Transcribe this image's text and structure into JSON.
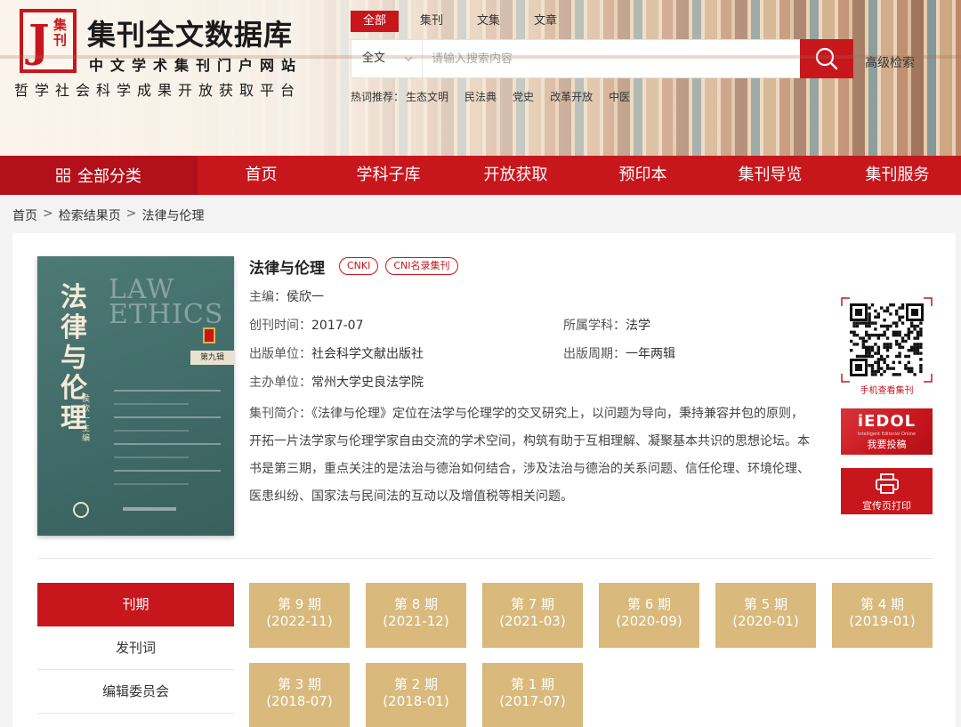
{
  "logo": {
    "mark_letter": "J",
    "mark_chars": "集刊",
    "title": "集刊全文数据库",
    "subtitle": "中文学术集刊门户网站",
    "slogan": "哲学社会科学成果开放获取平台"
  },
  "search": {
    "tabs": [
      {
        "label": "全部",
        "active": true
      },
      {
        "label": "集刊",
        "active": false
      },
      {
        "label": "文集",
        "active": false
      },
      {
        "label": "文章",
        "active": false
      }
    ],
    "scope": "全文",
    "placeholder": "请输入搜索内容",
    "advanced": "高级检索",
    "hot_label": "热词推荐：",
    "hot_words": [
      "生态文明",
      "民法典",
      "党史",
      "改革开放",
      "中医"
    ]
  },
  "nav": {
    "all_categories": "全部分类",
    "items": [
      "首页",
      "学科子库",
      "开放获取",
      "预印本",
      "集刊导览",
      "集刊服务"
    ]
  },
  "breadcrumb": [
    "首页",
    "检索结果页",
    "法律与伦理"
  ],
  "journal": {
    "title": "法律与伦理",
    "tags": [
      "CNKI",
      "CNI名录集刊"
    ],
    "editor_label": "主编：",
    "editor": "侯欣一",
    "founded_label": "创刊时间：",
    "founded": "2017-07",
    "subject_label": "所属学科：",
    "subject": "法学",
    "publisher_label": "出版单位：",
    "publisher": "社会科学文献出版社",
    "cycle_label": "出版周期：",
    "cycle": "一年两辑",
    "host_label": "主办单位：",
    "host": "常州大学史良法学院",
    "intro_label": "集刊简介：",
    "intro": "《法律与伦理》定位在法学与伦理学的交叉研究上，以问题为导向，秉持兼容并包的原则，开拓一片法学家与伦理学家自由交流的学术空间，构筑有助于互相理解、凝聚基本共识的思想论坛。本书是第三期，重点关注的是法治与德治如何结合，涉及法治与德治的关系问题、信任伦理、环境伦理、医患纠纷、国家法与民间法的互动以及增值税等相关问题。"
  },
  "cover": {
    "title_chars": "法律与伦理",
    "latin_top": "LAW",
    "latin_bottom": "ETHICS",
    "issue": "第九辑",
    "editors": "侯欣一 主编"
  },
  "sidebar_right": {
    "qr_caption": "手机查看集刊",
    "edol_logo": "iEDOL",
    "edol_small": "Intelligent Editorial Online",
    "submit": "我要投稿",
    "print": "宣传页打印"
  },
  "side_menu": [
    {
      "label": "刊期",
      "active": true
    },
    {
      "label": "发刊词",
      "active": false
    },
    {
      "label": "编辑委员会",
      "active": false
    }
  ],
  "issues": [
    {
      "no": "第 9 期",
      "date": "(2022-11)"
    },
    {
      "no": "第 8 期",
      "date": "(2021-12)"
    },
    {
      "no": "第 7 期",
      "date": "(2021-03)"
    },
    {
      "no": "第 6 期",
      "date": "(2020-09)"
    },
    {
      "no": "第 5 期",
      "date": "(2020-01)"
    },
    {
      "no": "第 4 期",
      "date": "(2019-01)"
    },
    {
      "no": "第 3 期",
      "date": "(2018-07)"
    },
    {
      "no": "第 2 期",
      "date": "(2018-01)"
    },
    {
      "no": "第 1 期",
      "date": "(2017-07)"
    }
  ],
  "colors": {
    "brand_red": "#c8161d",
    "issue_gold": "#d9b97c",
    "cover_teal": "#4e7a76"
  }
}
